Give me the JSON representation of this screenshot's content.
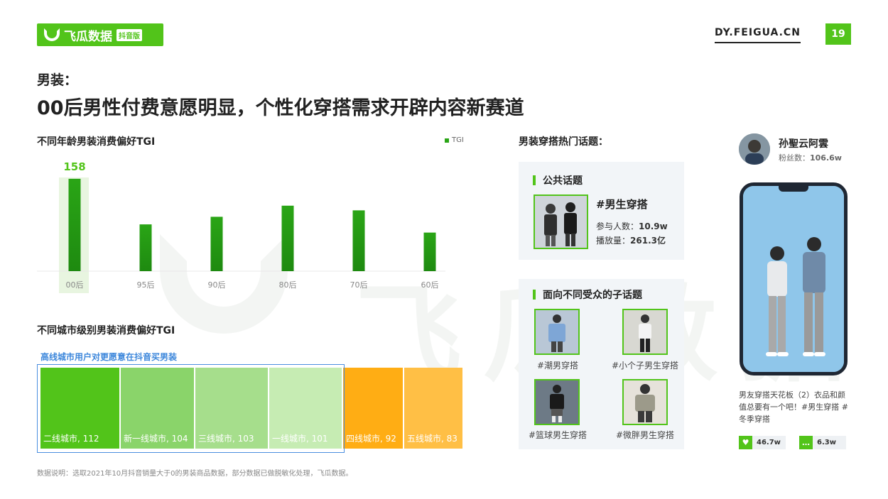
{
  "brand": {
    "name": "飞瓜数据",
    "tag": "抖音版",
    "site": "DY.FEIGUA.CN",
    "page": "19"
  },
  "heading": {
    "sub": "男装：",
    "main": "00后男性付费意愿明显，个性化穿搭需求开辟内容新赛道"
  },
  "watermark": "飞瓜数据",
  "colors": {
    "brand_green": "#52c41a",
    "bar_green": "#2aa516",
    "highlight_blue": "#4a8ee0",
    "orange": "#ffb020"
  },
  "age_chart_title": "不同年龄男装消费偏好TGI",
  "city_chart_title": "不同城市级别男装消费偏好TGI",
  "city_note": "高线城市用户对更愿意在抖音买男装",
  "chart_data": [
    {
      "type": "bar",
      "title": "不同年龄男装消费偏好TGI",
      "categories": [
        "00后",
        "95后",
        "90后",
        "80后",
        "70后",
        "60后"
      ],
      "series": [
        {
          "name": "TGI",
          "values": [
            158,
            80,
            93,
            112,
            104,
            66
          ]
        }
      ],
      "data_labels": [
        "158"
      ],
      "highlight_category": "00后",
      "ylim": [
        0,
        170
      ],
      "legend": "top-right",
      "grid": false
    },
    {
      "type": "treemap",
      "title": "不同城市级别男装消费偏好TGI",
      "categories": [
        "二线城市",
        "新一线城市",
        "三线城市",
        "一线城市",
        "四线城市",
        "五线城市"
      ],
      "values": [
        112,
        104,
        103,
        101,
        92,
        83
      ],
      "labels": [
        "二线城市, 112",
        "新一线城市, 104",
        "三线城市, 103",
        "一线城市, 101",
        "四线城市, 92",
        "五线城市, 83"
      ],
      "colors": [
        "#52c41a",
        "#8ad46a",
        "#a6de8c",
        "#c6ecb3",
        "#ffad14",
        "#ffbf45"
      ]
    }
  ],
  "topics": {
    "title": "男装穿搭热门话题：",
    "public_title": "公共话题",
    "public": {
      "name": "#男生穿搭",
      "participants_label": "参与人数：",
      "participants": "10.9w",
      "plays_label": "播放量：",
      "plays": "261.3亿"
    },
    "sub_title": "面向不同受众的子话题",
    "sub": [
      "#潮男穿搭",
      "#小个子男生穿搭",
      "#篮球男生穿搭",
      "#微胖男生穿搭"
    ]
  },
  "influencer": {
    "name": "孙聖云阿雲",
    "fans_label": "粉丝数：",
    "fans": "106.6w",
    "caption": "男友穿搭天花板（2）衣品和颜值总要有一个吧！#男生穿搭 #冬季穿搭",
    "likes": "46.7w",
    "comments": "6.3w"
  },
  "footnote": "数据说明：选取2021年10月抖音销量大于0的男装商品数据，部分数据已做脱敏化处理，飞瓜数据。"
}
